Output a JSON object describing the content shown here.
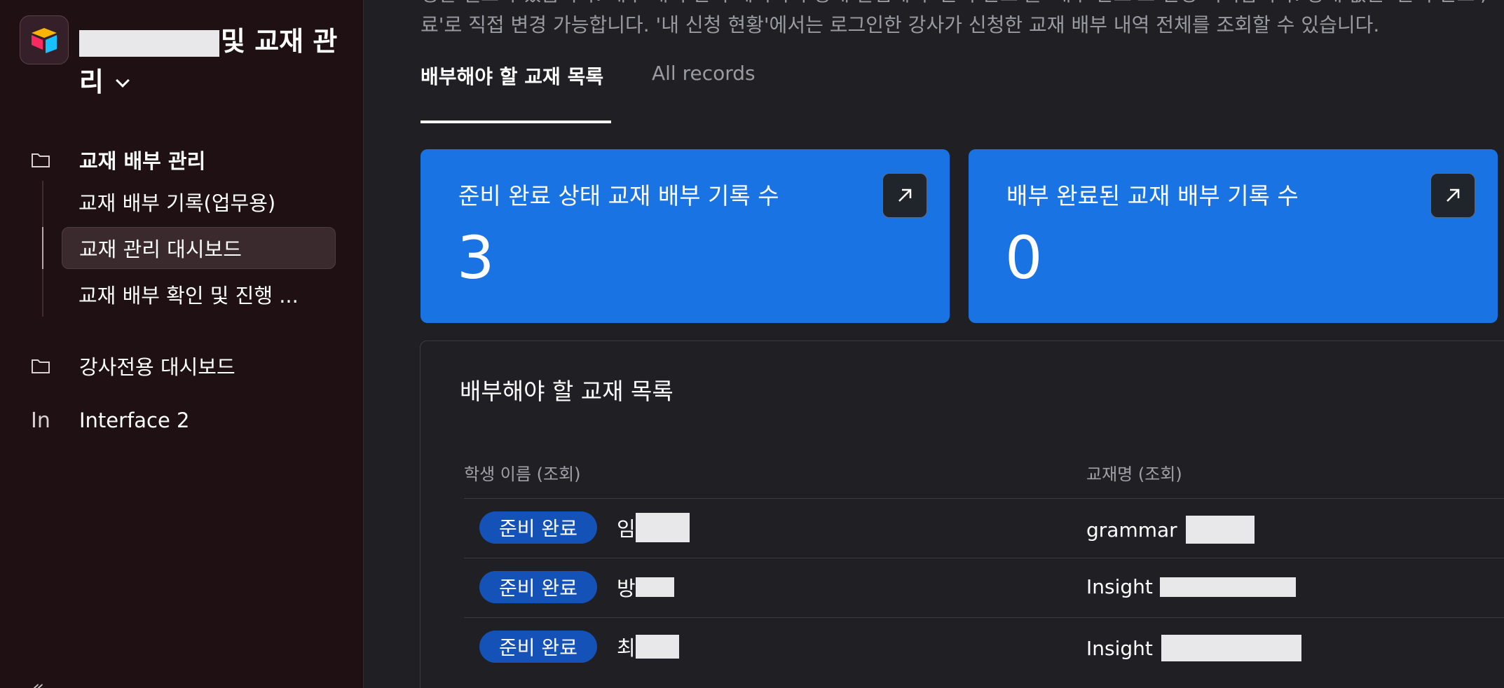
{
  "app": {
    "title_suffix": "및 교재 관리"
  },
  "sidebar": {
    "section1": {
      "label": "교재 배부 관리",
      "icon": "folder-icon"
    },
    "items": [
      {
        "label": "교재 배부 기록(업무용)"
      },
      {
        "label": "교재 관리 대시보드"
      },
      {
        "label": "교재 배부 확인 및 진행 ..."
      }
    ],
    "section2": {
      "label": "강사전용 대시보드",
      "icon": "folder-icon"
    },
    "section3": {
      "label": "Interface 2",
      "icon_text": "In"
    },
    "collapse_text": "«"
  },
  "main": {
    "description_line1": "정할 필요가 있습니다. 배부 내역 관리 페이지의 상태 칼럼에서 '준비 완료'를 '배부 완료'로 변경 처리합니다. 상태 값은 '준비 완료', '배부 완",
    "description_line2": "료'로 직접 변경 가능합니다. '내 신청 현황'에서는 로그인한 강사가 신청한 교재 배부 내역 전체를 조회할 수 있습니다.",
    "tabs": [
      {
        "label": "배부해야 할 교재 목록"
      },
      {
        "label": "All records"
      }
    ],
    "stats": [
      {
        "label": "준비 완료 상태 교재 배부 기록 수",
        "value": "3"
      },
      {
        "label": "배부 완료된 교재 배부 기록 수",
        "value": "0"
      }
    ],
    "panel": {
      "title": "배부해야 할 교재 목록",
      "columns": [
        "학생 이름 (조회)",
        "교재명 (조회)"
      ],
      "rows": [
        {
          "status": "준비 완료",
          "student": "임",
          "book": "grammar"
        },
        {
          "status": "준비 완료",
          "student": "방",
          "book": "Insight"
        },
        {
          "status": "준비 완료",
          "student": "최",
          "book": "Insight"
        }
      ]
    }
  },
  "colors": {
    "sidebar_bg": "#1e1013",
    "main_bg": "#202024",
    "accent_blue": "#1a73e3",
    "badge_blue": "#1452b8"
  }
}
